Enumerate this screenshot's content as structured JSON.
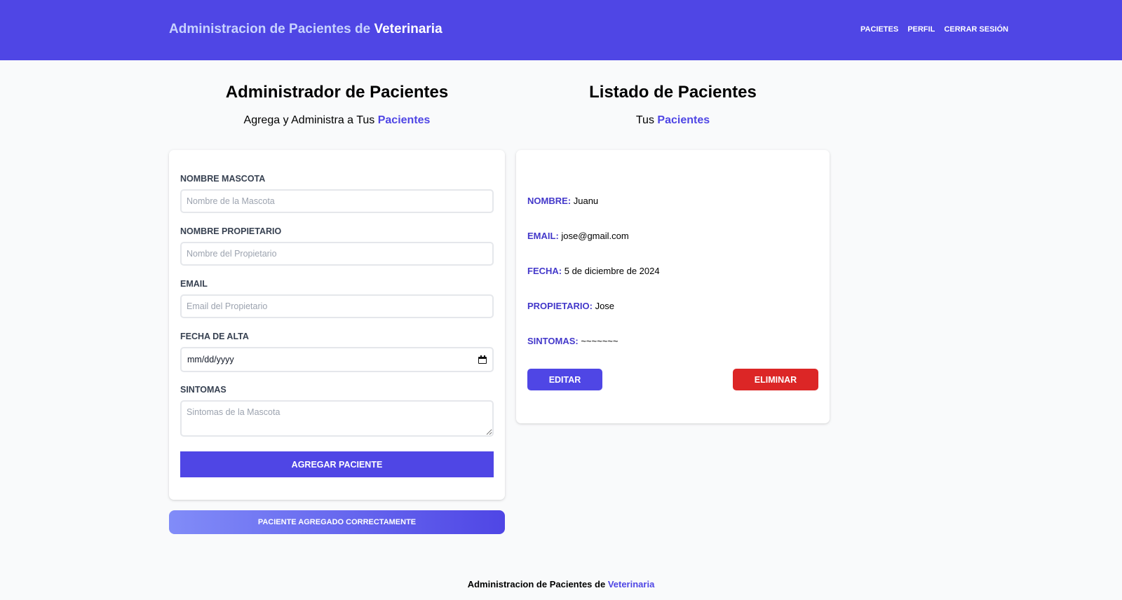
{
  "header": {
    "brand_prefix": "Administracion de Pacientes de ",
    "brand_strong": "Veterinaria",
    "nav": [
      "Pacietes",
      "Perfil",
      "Cerrar Sesión"
    ]
  },
  "left": {
    "title": "Administrador de Pacientes",
    "subtitle_prefix": "Agrega y Administra a Tus ",
    "subtitle_accent": "Pacientes"
  },
  "right": {
    "title": "Listado de Pacientes",
    "subtitle_prefix": "Tus ",
    "subtitle_accent": "Pacientes"
  },
  "form": {
    "mascota_label": "Nombre Mascota",
    "mascota_placeholder": "Nombre de la Mascota",
    "propietario_label": "Nombre Propietario",
    "propietario_placeholder": "Nombre del Propietario",
    "email_label": "Email",
    "email_placeholder": "Email del Propietario",
    "fecha_label": "Fecha de Alta",
    "fecha_value": "mm/dd/yyyy",
    "sintomas_label": "Sintomas",
    "sintomas_placeholder": "Sintomas de la Mascota",
    "submit_label": "Agregar Paciente"
  },
  "alert": {
    "message": "Paciente Agregado Correctamente"
  },
  "patient": {
    "nombre_key": "Nombre:",
    "nombre_value": "Juanu",
    "email_key": "Email:",
    "email_value": "jose@gmail.com",
    "fecha_key": "Fecha:",
    "fecha_value": "5 de diciembre de 2024",
    "propietario_key": "Propietario:",
    "propietario_value": "Jose",
    "sintomas_key": "Sintomas:",
    "sintomas_value": "~~~~~~~",
    "edit_label": "Editar",
    "delete_label": "Eliminar"
  },
  "footer": {
    "prefix": "Administracion de Pacientes de ",
    "accent": "Veterinaria"
  },
  "colors": {
    "primary": "#4f46e5",
    "danger": "#dc2626",
    "background": "#f9fafb"
  }
}
